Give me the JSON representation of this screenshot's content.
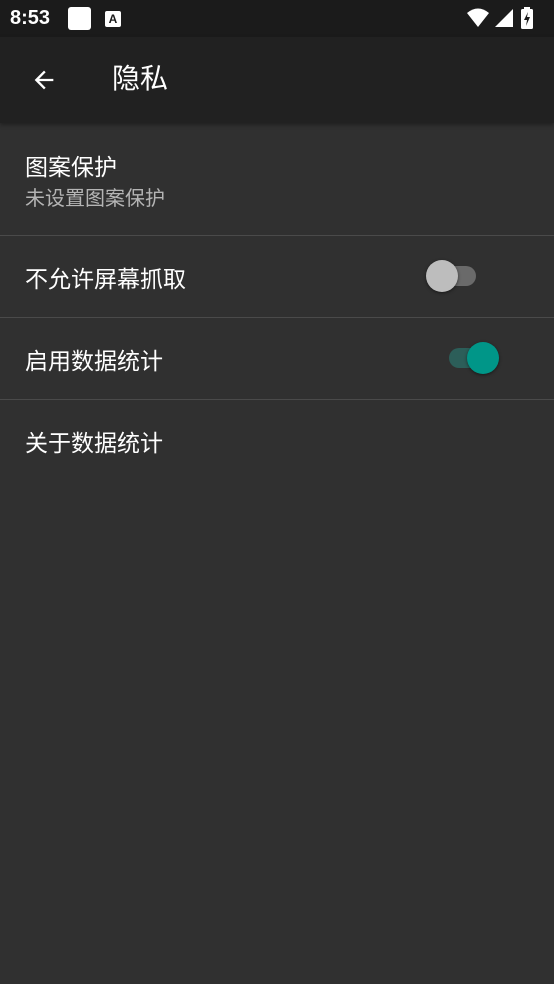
{
  "status_bar": {
    "time": "8:53",
    "icons": [
      "notification-square-icon",
      "a-notification-icon",
      "wifi-icon",
      "cell-signal-icon",
      "battery-icon"
    ],
    "a_icon_letter": "A"
  },
  "app_bar": {
    "back_icon": "arrow-back-icon",
    "title": "隐私"
  },
  "preferences": [
    {
      "title": "图案保护",
      "summary": "未设置图案保护"
    },
    {
      "title": "不允许屏幕抓取",
      "switch_on": false
    },
    {
      "title": "启用数据统计",
      "switch_on": true
    },
    {
      "title": "关于数据统计"
    }
  ],
  "colors": {
    "background": "#303030",
    "app_bar": "#212121",
    "status_bar": "#1b1b1b",
    "accent": "#009688",
    "switch_off_thumb": "#bdbdbd",
    "switch_off_track": "#6a6a6a",
    "switch_on_track": "#2c5e59",
    "divider": "#4a4a4a",
    "summary_text": "#b4b4b4"
  }
}
